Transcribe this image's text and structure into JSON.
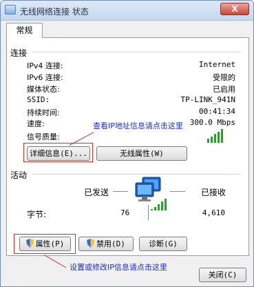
{
  "window": {
    "title": "无线网络连接 状态",
    "close_label": "X"
  },
  "tabs": {
    "general": "常规"
  },
  "connection": {
    "section_title": "连接",
    "rows": [
      {
        "label": "IPv4 连接:",
        "value": "Internet"
      },
      {
        "label": "IPv6 连接:",
        "value": "受限的"
      },
      {
        "label": "媒体状态:",
        "value": "已启用"
      },
      {
        "label": "SSID:",
        "value": "TP-LINK_941N"
      },
      {
        "label": "持续时间:",
        "value": "00:41:34"
      },
      {
        "label": "速度:",
        "value": "300.0 Mbps"
      }
    ],
    "signal_label": "信号质量:",
    "signal_strength": 5,
    "details_button": "详细信息(E)...",
    "wireless_props_button": "无线属性(W)"
  },
  "activity": {
    "section_title": "活动",
    "sent_label": "已发送",
    "received_label": "已接收",
    "bytes_label": "字节:",
    "sent_value": "76",
    "received_value": "4,610"
  },
  "buttons": {
    "properties": "属性(P)",
    "disable": "禁用(D)",
    "diagnose": "诊断(G)",
    "close": "关闭(C)"
  },
  "annotations": {
    "details_hint": "查看IP地址信息请点击这里",
    "properties_hint": "设置或修改IP信息请点击这里"
  },
  "colors": {
    "annotation_box": "#c0392b",
    "annotation_text": "#1a2fd0",
    "signal": "#27a427"
  }
}
